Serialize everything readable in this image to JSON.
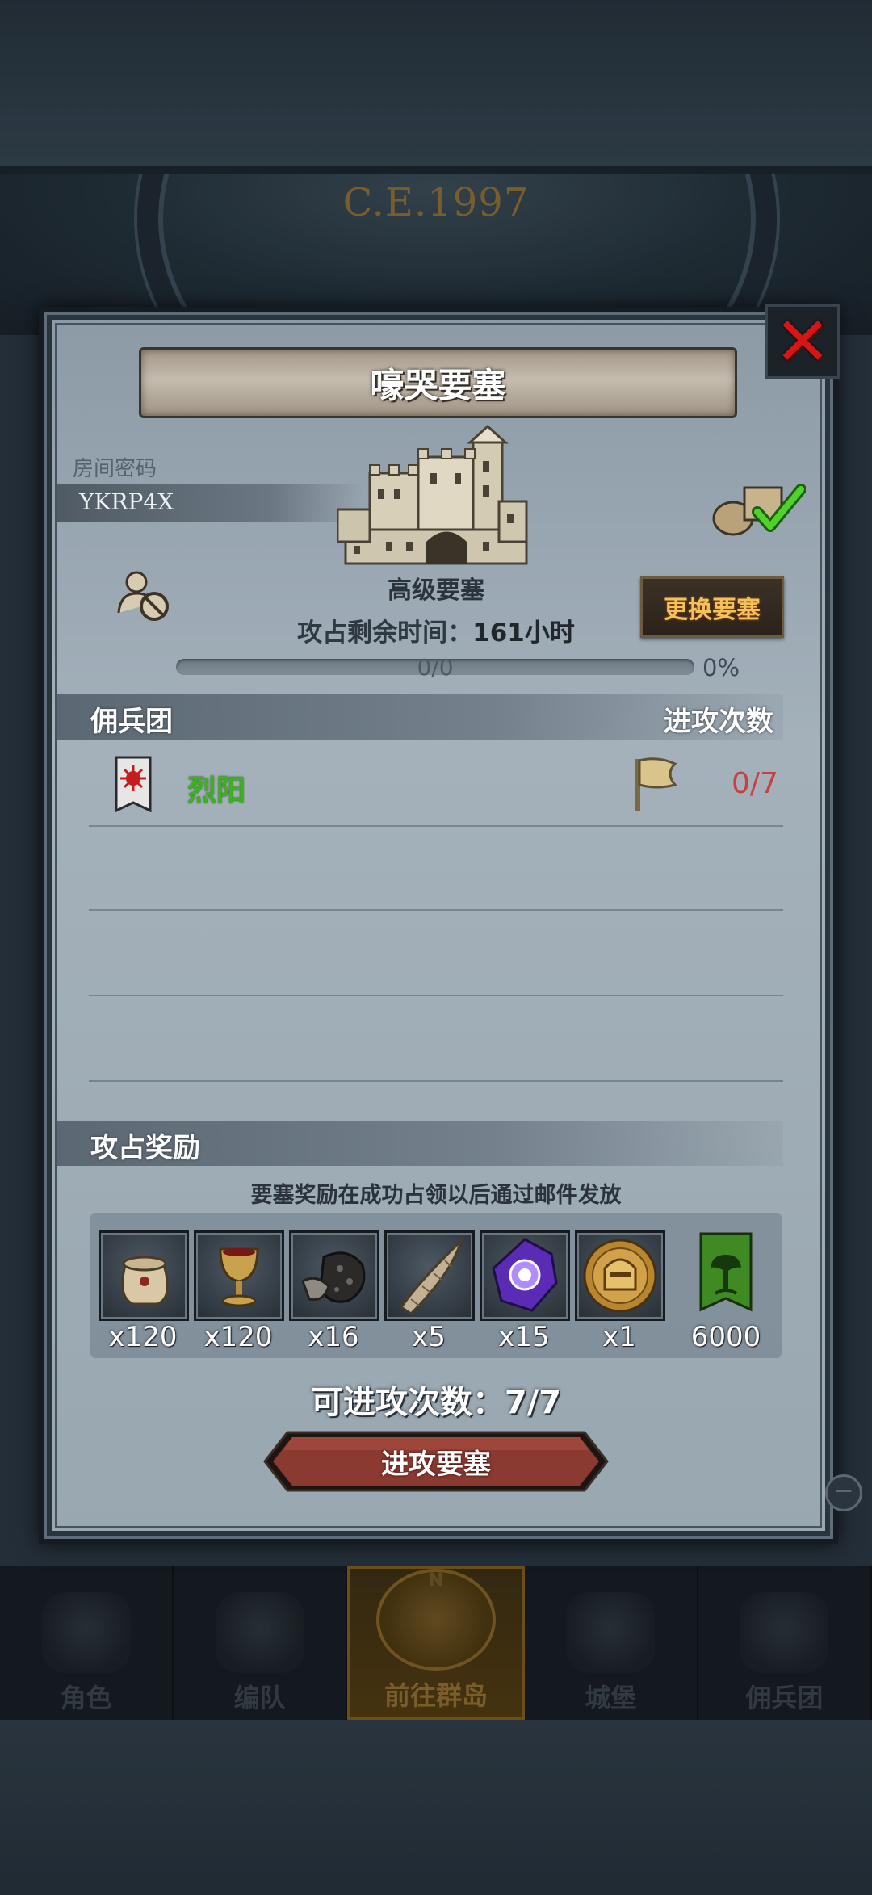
{
  "background": {
    "year_text": "C.E.1997"
  },
  "dialog": {
    "title": "嚎哭要塞",
    "room_label": "房间密码",
    "room_code": "YKRP4X",
    "fortress_level": "高级要塞",
    "remaining_time_label": "攻占剩余时间：",
    "remaining_time_value": "161小时",
    "change_button": "更换要塞",
    "progress_text": "0/0",
    "progress_percent": "0%",
    "progress_value": 0,
    "mercenary_header": "佣兵团",
    "attack_count_header": "进攻次数",
    "guild": {
      "name": "烈阳",
      "attack_count": "0/7"
    },
    "rewards_header": "攻占奖励",
    "rewards_note": "要塞奖励在成功占领以后通过邮件发放",
    "rewards": [
      {
        "icon": "pouch-icon",
        "count": "x120"
      },
      {
        "icon": "goblet-icon",
        "count": "x120"
      },
      {
        "icon": "ore-icon",
        "count": "x16"
      },
      {
        "icon": "horn-icon",
        "count": "x5"
      },
      {
        "icon": "purple-gem-icon",
        "count": "x15"
      },
      {
        "icon": "knight-medal-icon",
        "count": "x1"
      },
      {
        "icon": "tree-banner-icon",
        "count": "6000"
      }
    ],
    "attacks_left": "可进攻次数：7/7",
    "attack_button": "进攻要塞"
  },
  "nav": {
    "items": [
      {
        "label": "角色",
        "active": false
      },
      {
        "label": "编队",
        "active": false
      },
      {
        "label": "前往群岛",
        "active": true
      },
      {
        "label": "城堡",
        "active": false
      },
      {
        "label": "佣兵团",
        "active": false
      }
    ],
    "compass_letter": "N"
  },
  "colors": {
    "accent_gold": "#f4c25c",
    "guild_green": "#3cb31c",
    "attack_red": "#c84040",
    "close_red": "#d51616"
  }
}
